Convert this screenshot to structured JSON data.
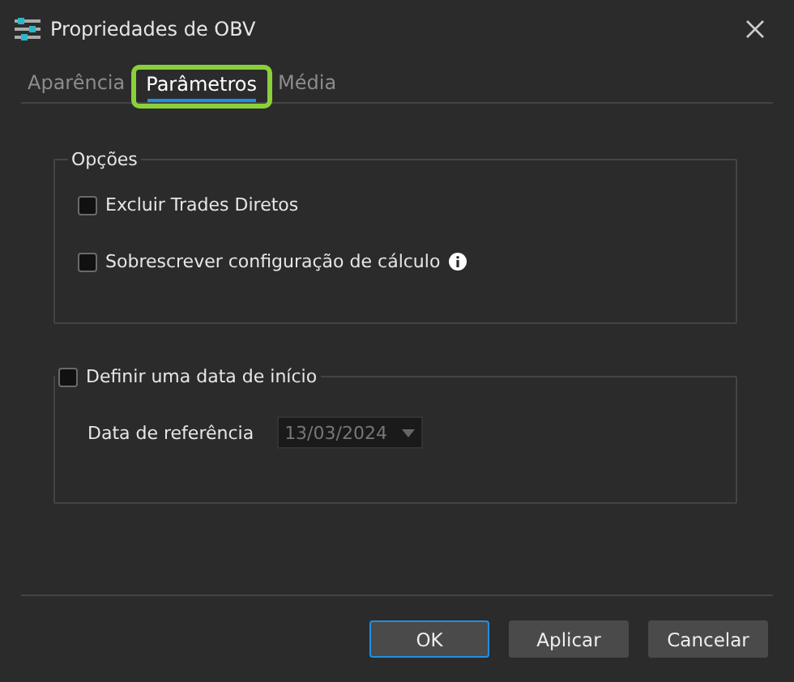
{
  "window": {
    "title": "Propriedades de OBV"
  },
  "tabs": [
    {
      "label": "Aparência",
      "selected": false,
      "highlighted": false
    },
    {
      "label": "Parâmetros",
      "selected": true,
      "highlighted": true
    },
    {
      "label": "Média",
      "selected": false,
      "highlighted": false
    }
  ],
  "options_group": {
    "title": "Opções",
    "items": [
      {
        "label": "Excluir Trades Diretos",
        "checked": false,
        "info": false
      },
      {
        "label": "Sobrescrever configuração de cálculo",
        "checked": false,
        "info": true
      }
    ]
  },
  "start_date_group": {
    "title": "Definir uma data de início",
    "checked": false,
    "field_label": "Data de referência",
    "date_value": "13/03/2024",
    "disabled": true
  },
  "buttons": [
    {
      "label": "OK",
      "default": true
    },
    {
      "label": "Aplicar",
      "default": false
    },
    {
      "label": "Cancelar",
      "default": false
    }
  ]
}
